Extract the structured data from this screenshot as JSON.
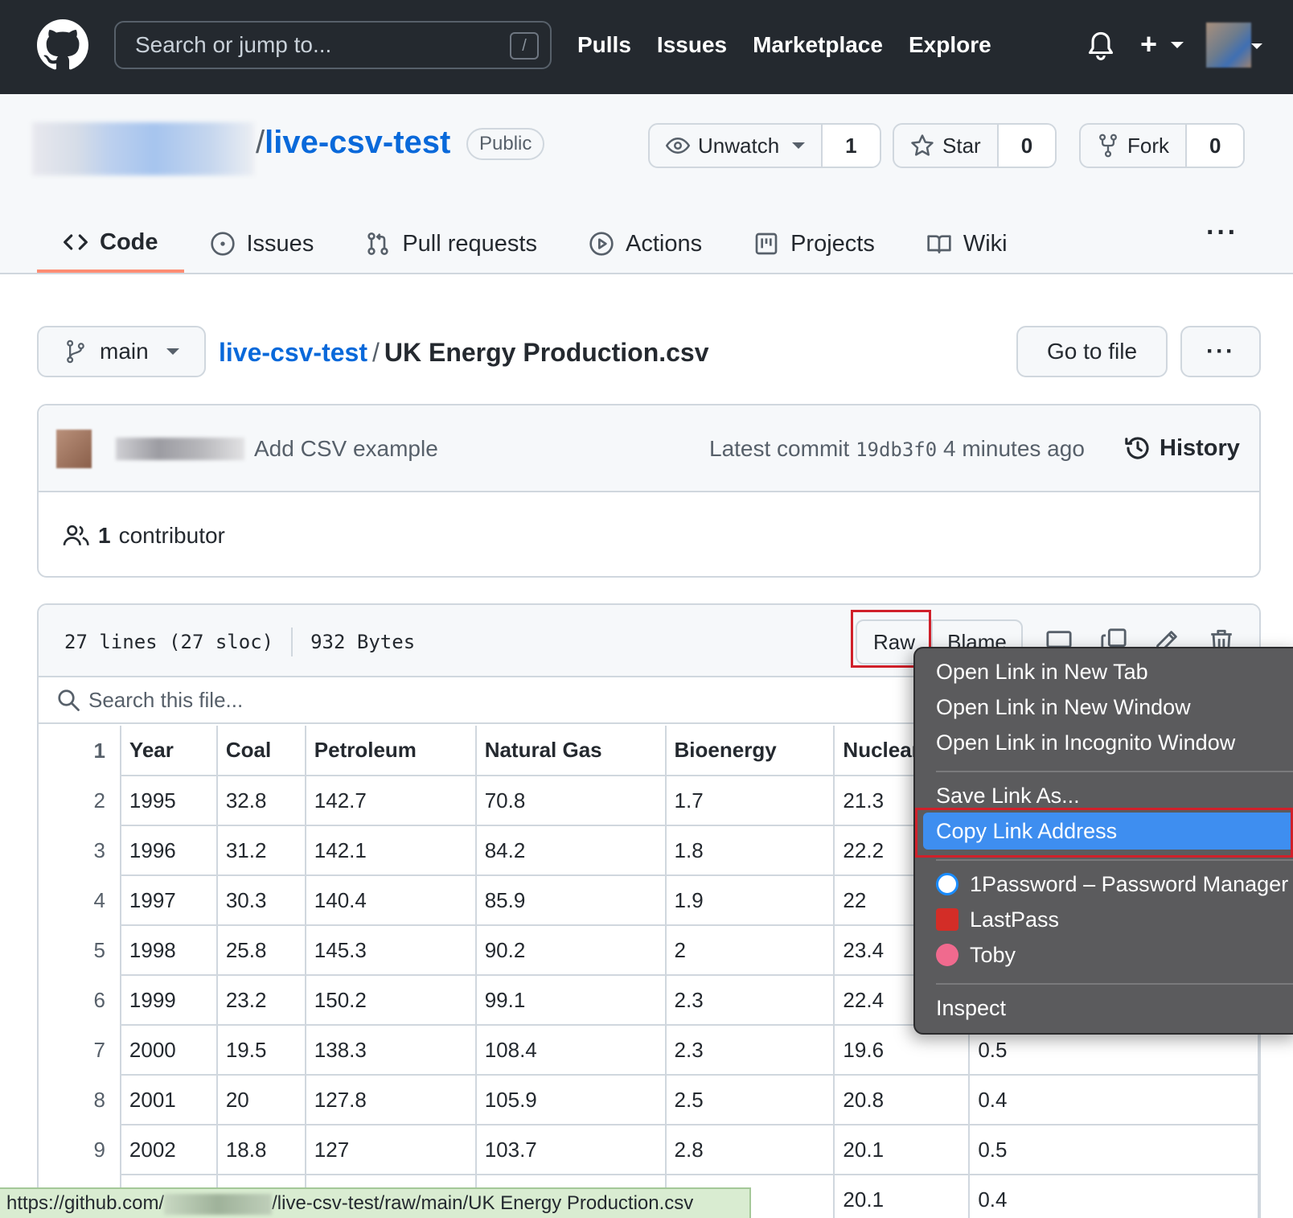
{
  "header": {
    "search_placeholder": "Search or jump to...",
    "search_shortcut": "/",
    "nav": [
      "Pulls",
      "Issues",
      "Marketplace",
      "Explore"
    ],
    "plus_symbol": "+"
  },
  "repo": {
    "separator": "/",
    "name": "live-csv-test",
    "visibility": "Public",
    "unwatch_label": "Unwatch",
    "watch_count": "1",
    "star_label": "Star",
    "star_count": "0",
    "fork_label": "Fork",
    "fork_count": "0"
  },
  "tabs": [
    "Code",
    "Issues",
    "Pull requests",
    "Actions",
    "Projects",
    "Wiki"
  ],
  "tabs_more": "···",
  "path": {
    "branch": "main",
    "repo_link": "live-csv-test",
    "separator": "/",
    "file": "UK Energy Production.csv",
    "go_to_file": "Go to file",
    "more": "···"
  },
  "commit": {
    "message": "Add CSV example",
    "latest_prefix": "Latest commit",
    "sha": "19db3f0",
    "time": "4 minutes ago",
    "history": "History",
    "contributors_count": "1",
    "contributors_label": "contributor"
  },
  "file": {
    "lines": "27 lines (27 sloc)",
    "size": "932 Bytes",
    "raw": "Raw",
    "blame": "Blame",
    "search_placeholder": "Search this file..."
  },
  "table": {
    "headers": [
      "Year",
      "Coal",
      "Petroleum",
      "Natural Gas",
      "Bioenergy",
      "Nuclear",
      ""
    ],
    "rows": [
      {
        "ln": "1",
        "cells": [
          "Year",
          "Coal",
          "Petroleum",
          "Natural Gas",
          "Bioenergy",
          "Nuclear",
          ""
        ]
      },
      {
        "ln": "2",
        "cells": [
          "1995",
          "32.8",
          "142.7",
          "70.8",
          "1.7",
          "21.3",
          ""
        ]
      },
      {
        "ln": "3",
        "cells": [
          "1996",
          "31.2",
          "142.1",
          "84.2",
          "1.8",
          "22.2",
          ""
        ]
      },
      {
        "ln": "4",
        "cells": [
          "1997",
          "30.3",
          "140.4",
          "85.9",
          "1.9",
          "22",
          ""
        ]
      },
      {
        "ln": "5",
        "cells": [
          "1998",
          "25.8",
          "145.3",
          "90.2",
          "2",
          "23.4",
          ""
        ]
      },
      {
        "ln": "6",
        "cells": [
          "1999",
          "23.2",
          "150.2",
          "99.1",
          "2.3",
          "22.4",
          ""
        ]
      },
      {
        "ln": "7",
        "cells": [
          "2000",
          "19.5",
          "138.3",
          "108.4",
          "2.3",
          "19.6",
          "0.5"
        ]
      },
      {
        "ln": "8",
        "cells": [
          "2001",
          "20",
          "127.8",
          "105.9",
          "2.5",
          "20.8",
          "0.4"
        ]
      },
      {
        "ln": "9",
        "cells": [
          "2002",
          "18.8",
          "127",
          "103.7",
          "2.8",
          "20.1",
          "0.5"
        ]
      },
      {
        "ln": "",
        "cells": [
          "",
          "",
          "",
          "",
          "",
          "20.1",
          "0.4"
        ]
      }
    ]
  },
  "status_url": {
    "prefix": "https://github.com/",
    "suffix": "/live-csv-test/raw/main/UK Energy Production.csv"
  },
  "context_menu": {
    "open_new_tab": "Open Link in New Tab",
    "open_new_window": "Open Link in New Window",
    "open_incognito": "Open Link in Incognito Window",
    "save_link": "Save Link As...",
    "copy_link": "Copy Link Address",
    "ext_1password": "1Password – Password Manager",
    "ext_lastpass": "LastPass",
    "ext_toby": "Toby",
    "inspect": "Inspect"
  },
  "colors": {
    "header_bg": "#24292f",
    "link_blue": "#0969da",
    "active_tab_underline": "#fd8c73",
    "menu_highlight": "#3e8ef0",
    "annotation_red": "#d0202a"
  }
}
